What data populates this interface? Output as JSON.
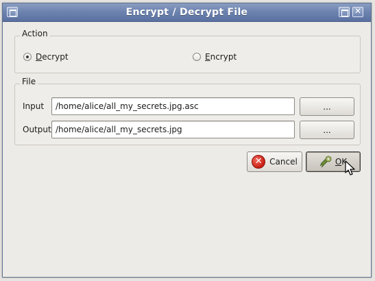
{
  "window": {
    "title": "Encrypt / Decrypt File"
  },
  "action_group": {
    "label": "Action",
    "decrypt": {
      "label_mnemonic": "D",
      "label_rest": "ecrypt",
      "selected": true
    },
    "encrypt": {
      "label_mnemonic": "E",
      "label_rest": "ncrypt",
      "selected": false
    }
  },
  "file_group": {
    "label": "File",
    "input": {
      "label": "Input",
      "value": "/home/alice/all_my_secrets.jpg.asc",
      "browse_label": "..."
    },
    "output": {
      "label": "Output",
      "value": "/home/alice/all_my_secrets.jpg",
      "browse_label": "..."
    }
  },
  "buttons": {
    "cancel": {
      "label": "Cancel",
      "icon": "cancel-icon"
    },
    "ok": {
      "label_mnemonic": "O",
      "label_rest": "K",
      "icon": "key-icon"
    }
  },
  "colors": {
    "titlebar": "#6e84b0",
    "cancel_red": "#c91e12"
  }
}
